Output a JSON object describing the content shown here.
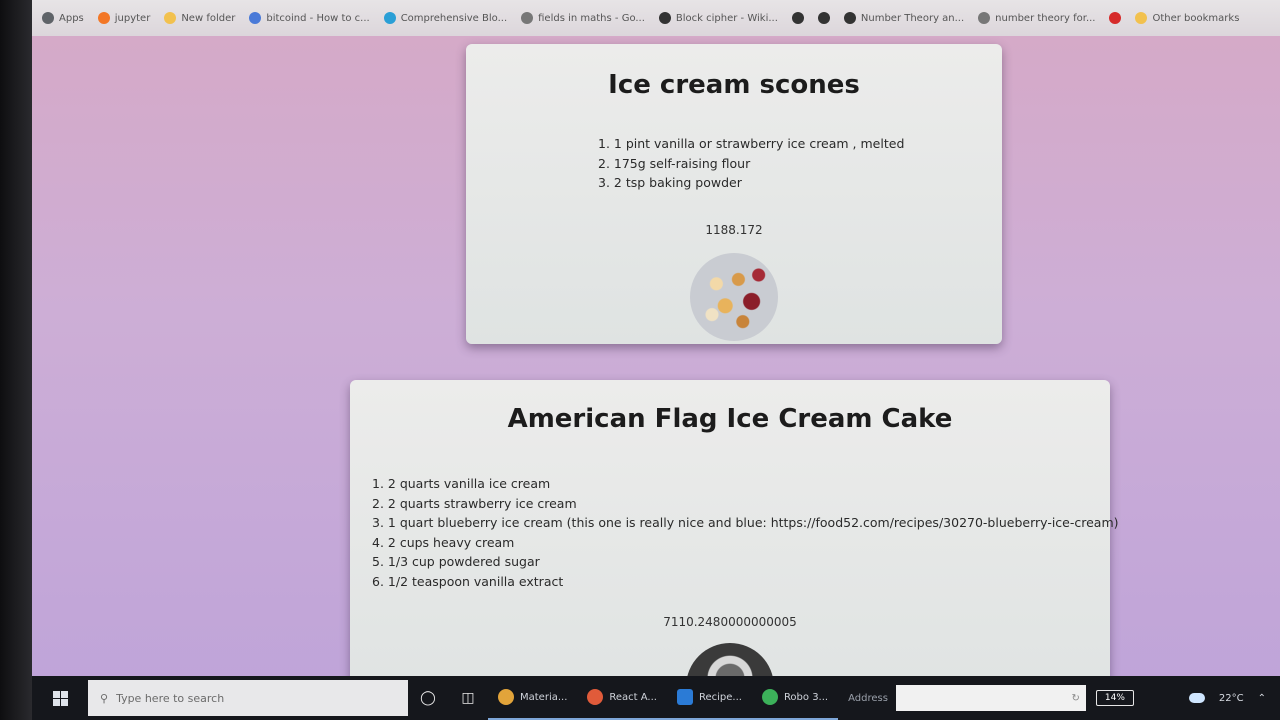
{
  "bookmarks": [
    {
      "label": "Apps",
      "icon": "apps-grid-icon",
      "color": "#5f6368"
    },
    {
      "label": "jupyter",
      "icon": "jupyter-icon",
      "color": "#f37726"
    },
    {
      "label": "New folder",
      "icon": "folder-icon",
      "color": "#f2c14e"
    },
    {
      "label": "bitcoind - How to c...",
      "icon": "page-icon",
      "color": "#4a7ad8"
    },
    {
      "label": "Comprehensive Blo...",
      "icon": "globe-icon",
      "color": "#2a9fd6"
    },
    {
      "label": "fields in maths - Go...",
      "icon": "google-icon",
      "color": "#777777"
    },
    {
      "label": "Block cipher - Wiki...",
      "icon": "wikipedia-icon",
      "color": "#333333"
    },
    {
      "label": "",
      "icon": "globe-icon",
      "color": "#333333"
    },
    {
      "label": "",
      "icon": "globe-icon",
      "color": "#333333"
    },
    {
      "label": "Number Theory an...",
      "icon": "globe-icon",
      "color": "#333333"
    },
    {
      "label": "number theory for...",
      "icon": "google-icon",
      "color": "#777777"
    },
    {
      "label": "",
      "icon": "youtube-icon",
      "color": "#d62a2a"
    },
    {
      "label": "Other bookmarks",
      "icon": "folder-icon",
      "color": "#f2c14e"
    }
  ],
  "recipes": [
    {
      "title": "Ice cream scones",
      "ingredients": [
        "1. 1 pint vanilla or strawberry ice cream , melted",
        "2. 175g self-raising flour",
        "3. 2 tsp baking powder"
      ],
      "calories": "1188.172"
    },
    {
      "title": "American Flag Ice Cream Cake",
      "ingredients": [
        "1. 2 quarts vanilla ice cream",
        "2. 2 quarts strawberry ice cream",
        "3. 1 quart blueberry ice cream (this one is really nice and blue: https://food52.com/recipes/30270-blueberry-ice-cream)",
        "4. 2 cups heavy cream",
        "5. 1/3 cup powdered sugar",
        "6. 1/2 teaspoon vanilla extract"
      ],
      "calories": "7110.2480000000005"
    }
  ],
  "taskbar": {
    "search_placeholder": "Type here to search",
    "apps": [
      {
        "label": "Materia...",
        "color": "#e2a43a"
      },
      {
        "label": "React A...",
        "color": "#e05b3a"
      },
      {
        "label": "Recipe...",
        "color": "#2b7bd6"
      },
      {
        "label": "Robo 3...",
        "color": "#3cb15a"
      }
    ],
    "address_label": "Address",
    "battery": "14%",
    "temperature": "22°C"
  }
}
